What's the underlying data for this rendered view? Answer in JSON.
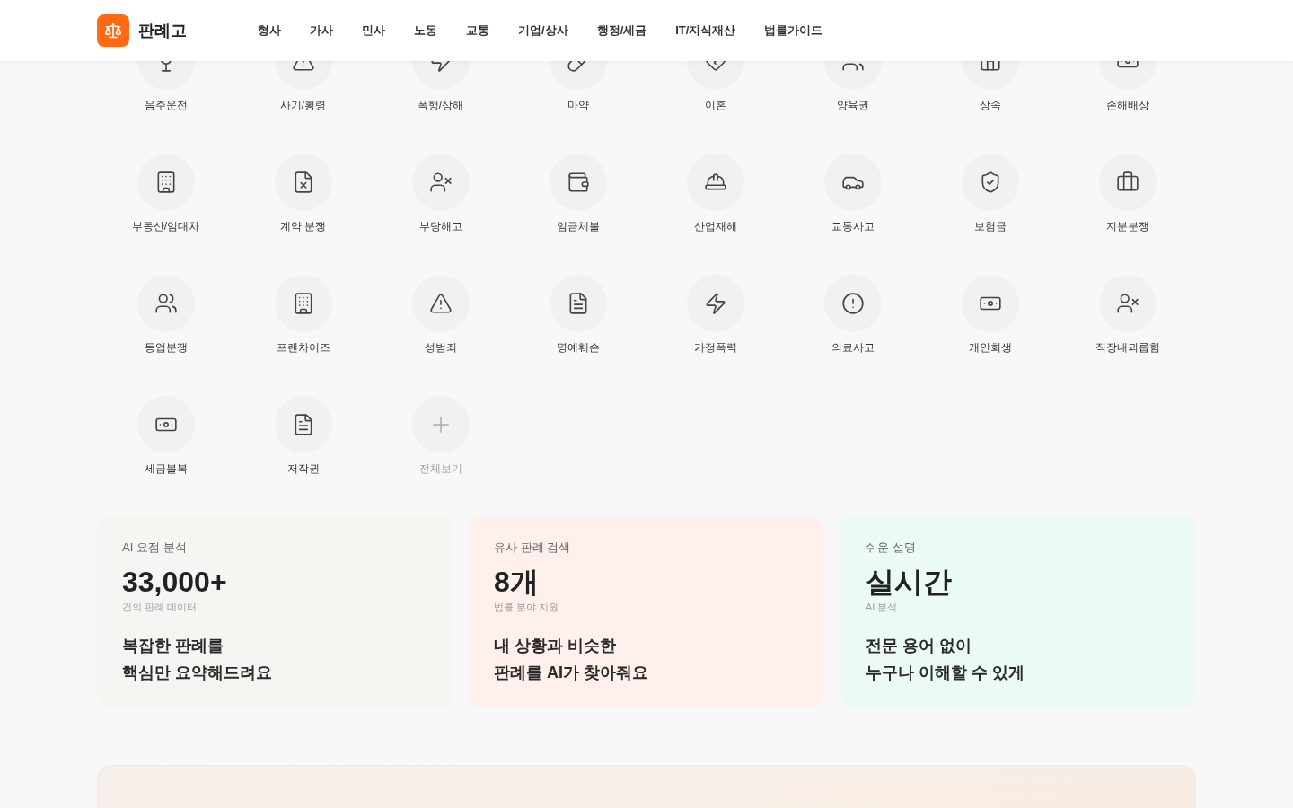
{
  "header": {
    "brand": "판례고",
    "nav": [
      {
        "label": "형사"
      },
      {
        "label": "가사"
      },
      {
        "label": "민사"
      },
      {
        "label": "노동"
      },
      {
        "label": "교통"
      },
      {
        "label": "기업/상사"
      },
      {
        "label": "행정/세금"
      },
      {
        "label": "IT/지식재산"
      },
      {
        "label": "법률가이드"
      }
    ]
  },
  "categories": [
    {
      "label": "음주운전",
      "kind": "category"
    },
    {
      "label": "사기/횡령",
      "kind": "category"
    },
    {
      "label": "폭행/상해",
      "kind": "category"
    },
    {
      "label": "마약",
      "kind": "category"
    },
    {
      "label": "이혼",
      "kind": "category"
    },
    {
      "label": "양육권",
      "kind": "category"
    },
    {
      "label": "상속",
      "kind": "category"
    },
    {
      "label": "손해배상",
      "kind": "category"
    },
    {
      "label": "부동산/임대차",
      "kind": "category"
    },
    {
      "label": "계약 분쟁",
      "kind": "category"
    },
    {
      "label": "부당해고",
      "kind": "category"
    },
    {
      "label": "임금체불",
      "kind": "category"
    },
    {
      "label": "산업재해",
      "kind": "category"
    },
    {
      "label": "교통사고",
      "kind": "category"
    },
    {
      "label": "보험금",
      "kind": "category"
    },
    {
      "label": "지분분쟁",
      "kind": "category"
    },
    {
      "label": "동업분쟁",
      "kind": "category"
    },
    {
      "label": "프랜차이즈",
      "kind": "category"
    },
    {
      "label": "성범죄",
      "kind": "category"
    },
    {
      "label": "명예훼손",
      "kind": "category"
    },
    {
      "label": "가정폭력",
      "kind": "category"
    },
    {
      "label": "의료사고",
      "kind": "category"
    },
    {
      "label": "개인회생",
      "kind": "category"
    },
    {
      "label": "직장내괴롭힘",
      "kind": "category"
    },
    {
      "label": "세금불복",
      "kind": "category"
    },
    {
      "label": "저작권",
      "kind": "category"
    },
    {
      "label": "전체보기",
      "kind": "more"
    }
  ],
  "features": [
    {
      "eyebrow": "AI 요점 분석",
      "stat": "33,000+",
      "caption": "건의 판례 데이터",
      "lines": [
        "복잡한 판례를",
        "핵심만 요약해드려요"
      ],
      "color": "#f7f5f2"
    },
    {
      "eyebrow": "유사 판례 검색",
      "stat": "8개",
      "caption": "법률 분야 지원",
      "lines": [
        "내 상황과 비슷한",
        "판례를 AI가 찾아줘요"
      ],
      "color": "#fff0ee"
    },
    {
      "eyebrow": "쉬운 설명",
      "stat": "실시간",
      "caption": "AI 분석",
      "lines": [
        "전문 용어 없이",
        "누구나 이해할 수 있게"
      ],
      "color": "#ebfbf4"
    }
  ]
}
